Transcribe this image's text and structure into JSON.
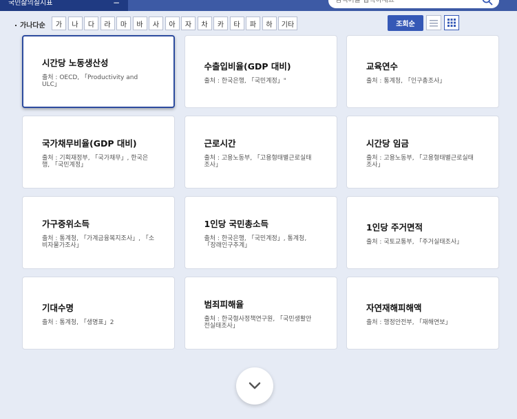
{
  "header": {
    "category_tab": "국민삶의질지표",
    "collapse_symbol": "−",
    "search": {
      "placeholder": "검색어를 입력하세요"
    }
  },
  "filter": {
    "label": "가나다순",
    "letters": [
      "가",
      "나",
      "다",
      "라",
      "마",
      "바",
      "사",
      "아",
      "자",
      "차",
      "카",
      "타",
      "파",
      "하",
      "기타"
    ]
  },
  "toolbar": {
    "sort_label": "조회순"
  },
  "cards": [
    {
      "title": "시간당 노동생산성",
      "source": "출처 : OECD, 「Productivity and ULC」"
    },
    {
      "title": "수출입비율(GDP 대비)",
      "source": "출처 : 한국은행, 「국민계정」\""
    },
    {
      "title": "교육연수",
      "source": "출처 : 통계청, 「인구총조사」"
    },
    {
      "title": "국가채무비율(GDP 대비)",
      "source": "출처 : 기획재정부, 「국가채무」, 한국은행, 「국민계정」"
    },
    {
      "title": "근로시간",
      "source": "출처 : 고용노동부, 「고용형태별근로실태조사」"
    },
    {
      "title": "시간당 임금",
      "source": "출처 : 고용노동부, 「고용형태별근로실태조사」"
    },
    {
      "title": "가구중위소득",
      "source": "출처 : 통계청, 「가계금융복지조사」, 「소비자물가조사」"
    },
    {
      "title": "1인당 국민총소득",
      "source": "출처 : 한국은행, 「국민계정」, 통계청, 「장래인구추계」"
    },
    {
      "title": "1인당 주거면적",
      "source": "출처 : 국토교통부, 「주거실태조사」"
    },
    {
      "title": "기대수명",
      "source": "출처 : 통계청, 「생명표」2"
    },
    {
      "title": "범죄피해율",
      "source": "출처 : 한국형사정책연구원, 「국민생활안전실태조사」"
    },
    {
      "title": "자연재해피해액",
      "source": "출처 : 행정안전부, 「재해연보」"
    }
  ],
  "icons": {
    "search": "search-icon",
    "list_view": "list-view-icon",
    "grid_view": "grid-view-icon",
    "more": "chevron-down-icon"
  },
  "colors": {
    "primary": "#3558b6",
    "header": "#3d5aa5",
    "tab": "#1f3a82",
    "background": "#e6ebf5"
  }
}
